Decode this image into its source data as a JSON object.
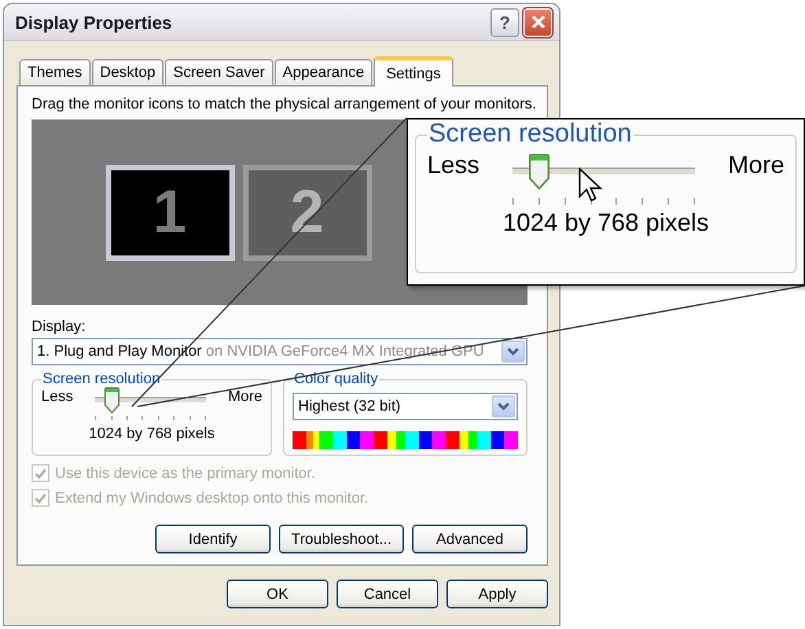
{
  "window": {
    "title": "Display Properties",
    "help_label": "?"
  },
  "tabs": [
    {
      "label": "Themes",
      "selected": false
    },
    {
      "label": "Desktop",
      "selected": false
    },
    {
      "label": "Screen Saver",
      "selected": false
    },
    {
      "label": "Appearance",
      "selected": false
    },
    {
      "label": "Settings",
      "selected": true
    }
  ],
  "settings": {
    "description": "Drag the monitor icons to match the physical arrangement of your monitors.",
    "monitors": [
      {
        "label": "1",
        "selected": true
      },
      {
        "label": "2",
        "selected": false
      }
    ],
    "display_label": "Display:",
    "display_device": "1. Plug and Play Monitor",
    "display_adapter": "on NVIDIA GeForce4 MX Integrated GPU",
    "screen_resolution": {
      "title": "Screen resolution",
      "min_label": "Less",
      "max_label": "More",
      "level": 0.143,
      "reading": "1024 by 768 pixels"
    },
    "color_quality": {
      "title": "Color quality",
      "value": "Highest (32 bit)"
    },
    "options": [
      {
        "label": "Use this device as the primary monitor.",
        "checked": true,
        "disabled": true
      },
      {
        "label": "Extend my Windows desktop onto this monitor.",
        "checked": true,
        "disabled": true
      }
    ],
    "buttons": [
      "Identify",
      "Troubleshoot...",
      "Advanced"
    ]
  },
  "dialog_buttons": [
    "OK",
    "Cancel",
    "Apply"
  ],
  "zoom_callout": {
    "title": "Screen resolution",
    "min_label": "Less",
    "max_label": "More",
    "level": 0.143,
    "reading": "1024 by 768 pixels"
  }
}
